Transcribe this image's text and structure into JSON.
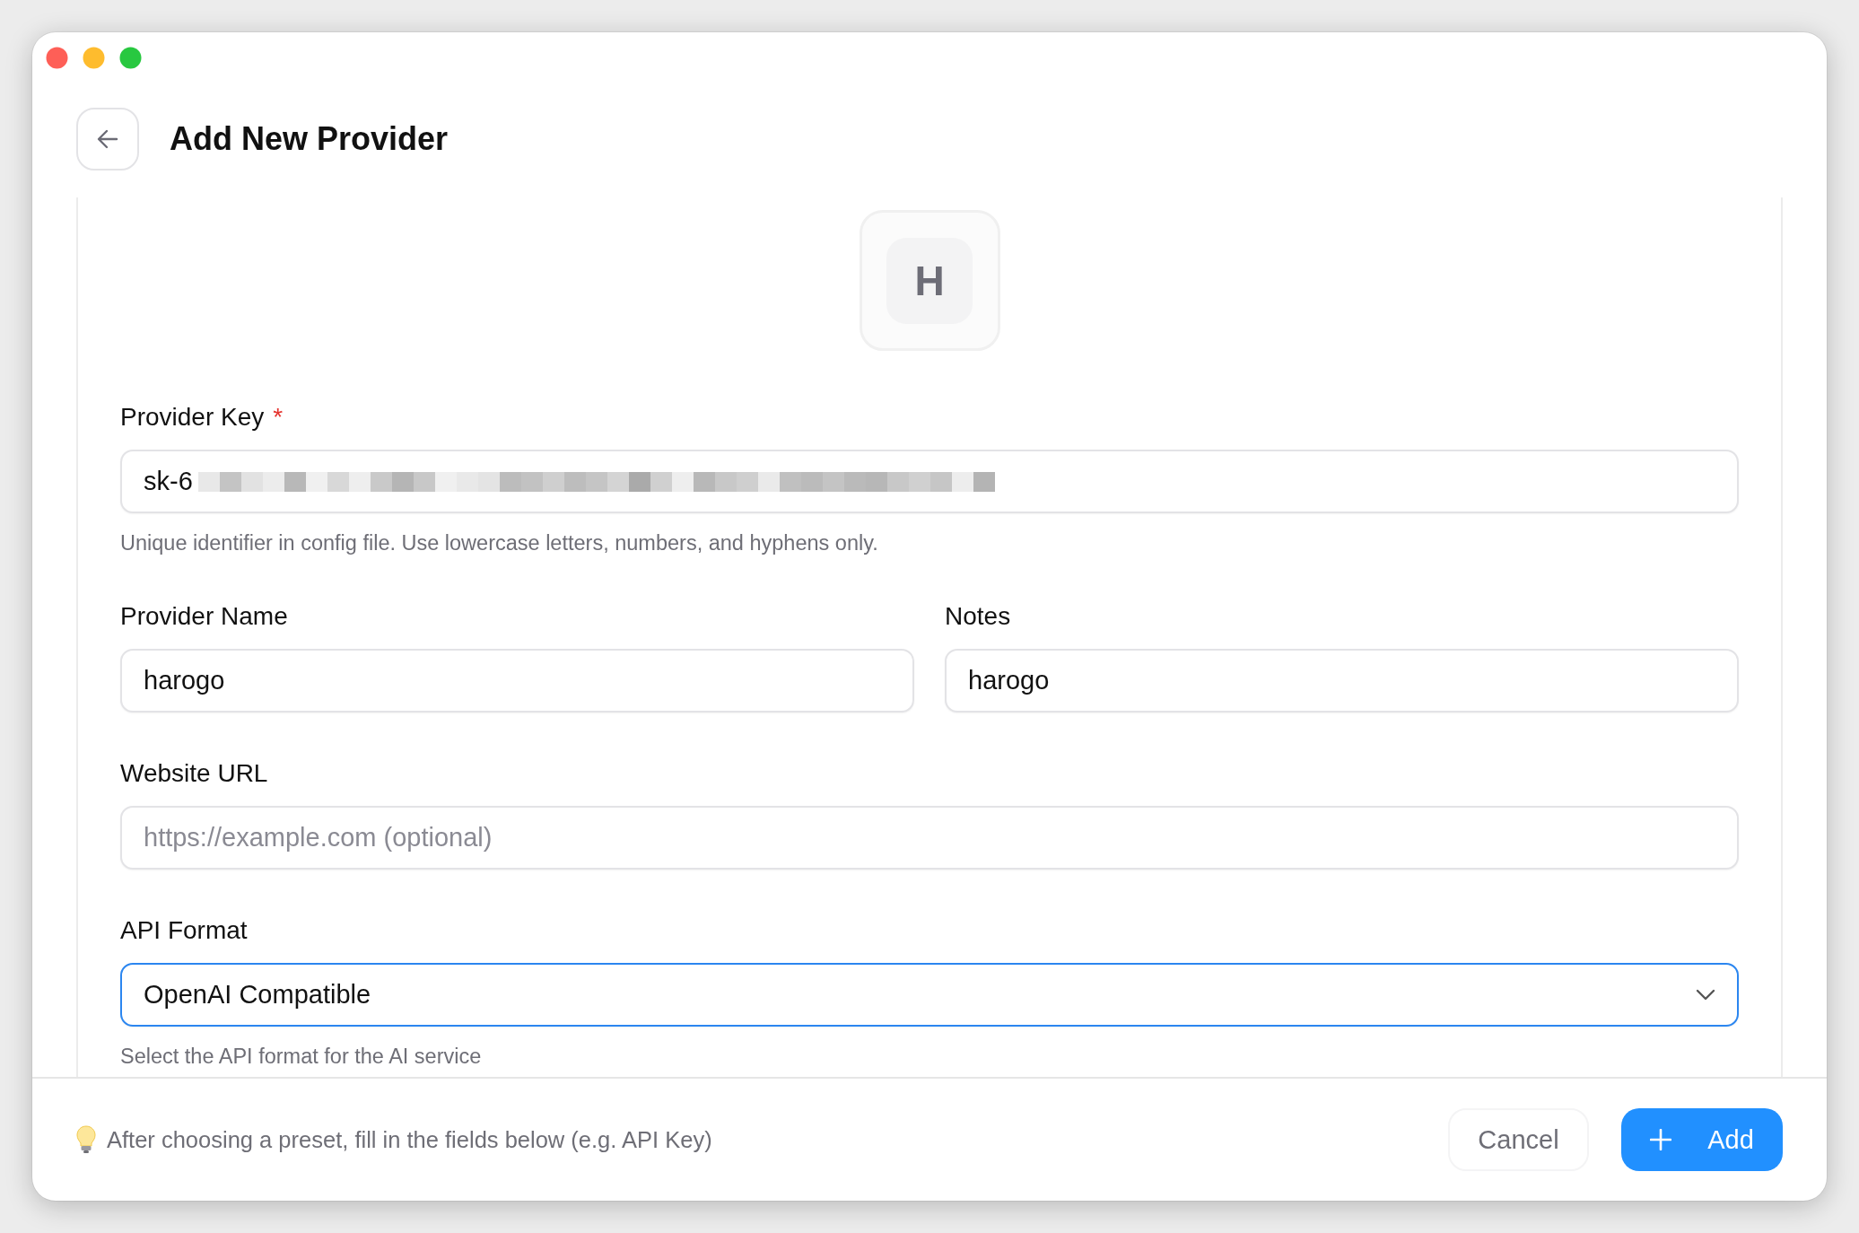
{
  "window": {
    "title": "Add New Provider"
  },
  "avatar": {
    "letter": "H"
  },
  "fields": [
    {
      "kind": "text",
      "label": "Provider Key",
      "required_mark": "*",
      "value": "sk-6",
      "redacted": true,
      "hint": "Unique identifier in config file. Use lowercase letters, numbers, and hyphens only."
    },
    {
      "kind": "pair",
      "items": [
        {
          "label": "Provider Name",
          "value": "harogo"
        },
        {
          "label": "Notes",
          "value": "harogo"
        }
      ]
    },
    {
      "kind": "text",
      "label": "Website URL",
      "placeholder": "https://example.com (optional)"
    },
    {
      "kind": "select",
      "label": "API Format",
      "focused": true,
      "value": "OpenAI Compatible",
      "hint": "Select the API format for the AI service"
    }
  ],
  "footer": {
    "tip": "After choosing a preset, fill in the fields below (e.g. API Key)",
    "buttons": [
      {
        "kind": "secondary",
        "label": "Cancel"
      },
      {
        "kind": "primary",
        "label": "Add"
      }
    ]
  }
}
